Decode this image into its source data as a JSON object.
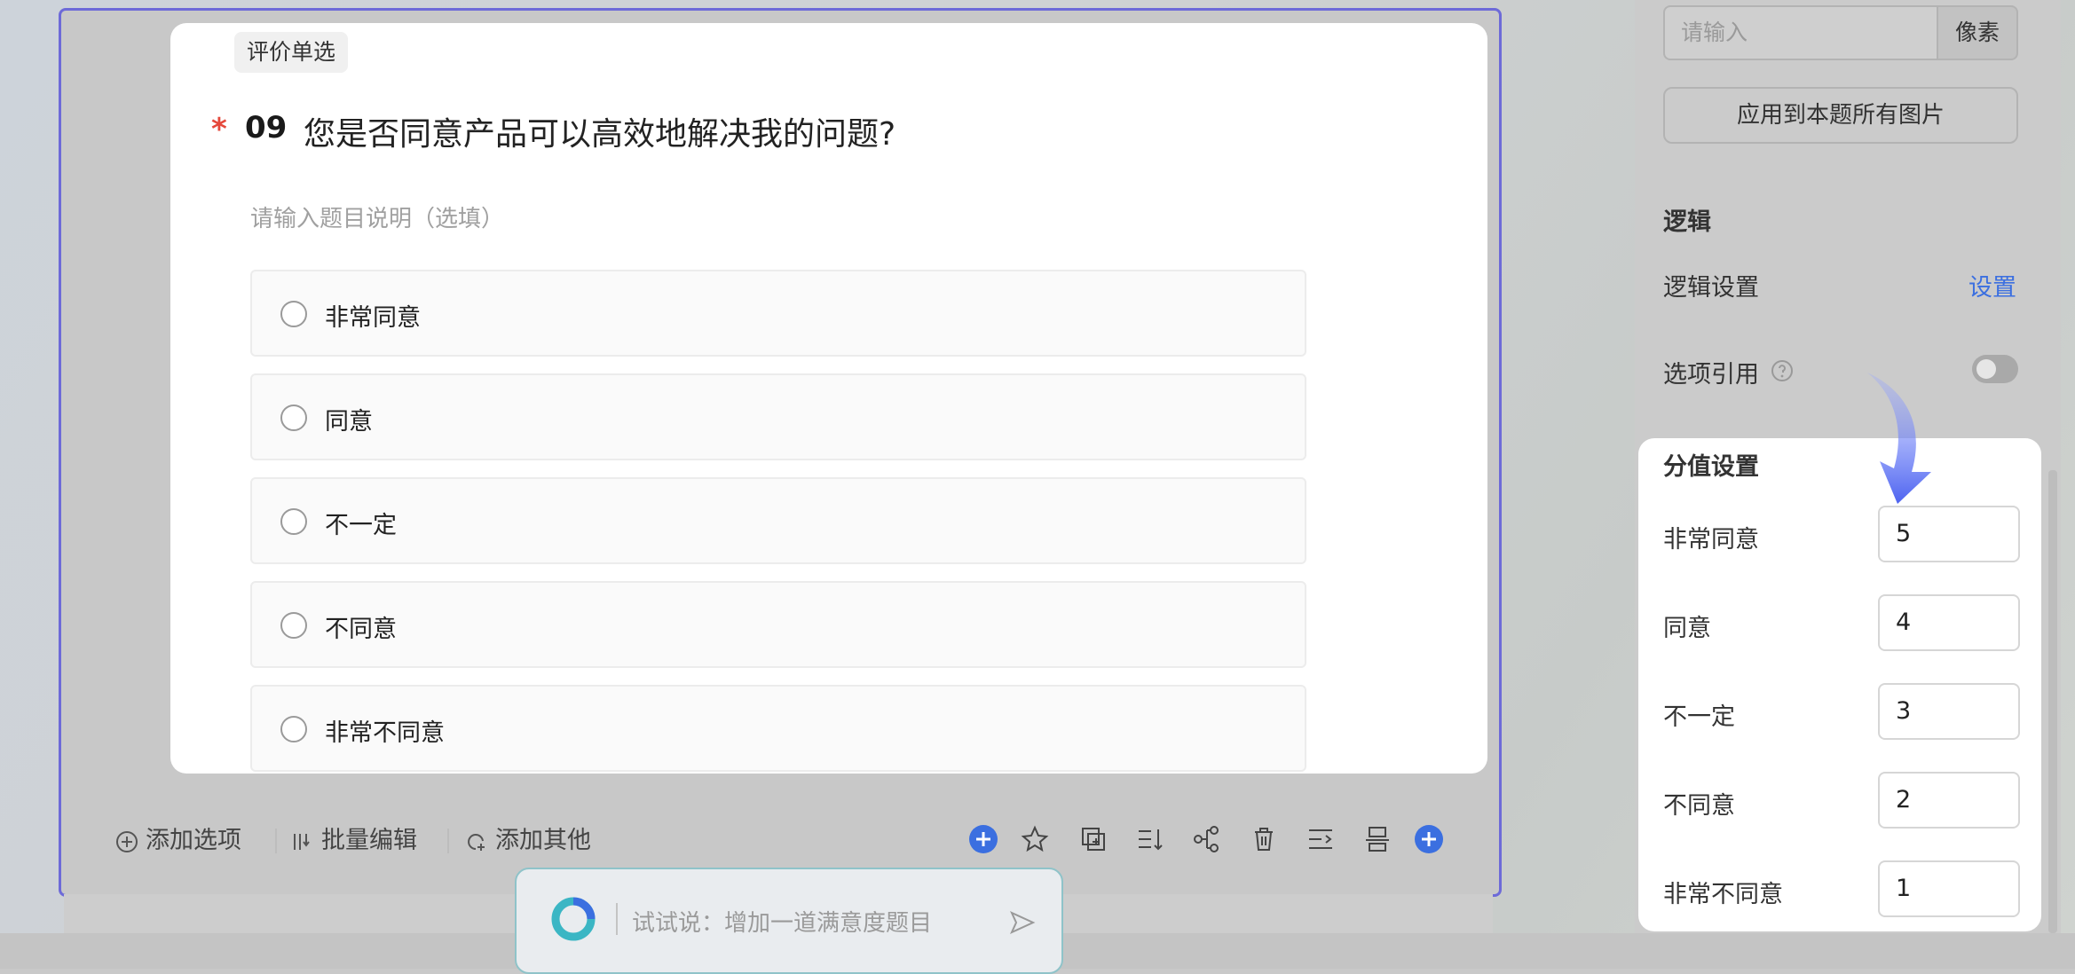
{
  "question": {
    "type_badge": "评价单选",
    "required_mark": "*",
    "number": "09",
    "title": "您是否同意产品可以高效地解决我的问题?",
    "description_placeholder": "请输入题目说明（选填）",
    "options": [
      {
        "label": "非常同意"
      },
      {
        "label": "同意"
      },
      {
        "label": "不一定"
      },
      {
        "label": "不同意"
      },
      {
        "label": "非常不同意"
      }
    ]
  },
  "toolbar": {
    "add_option": "添加选项",
    "batch_edit": "批量编辑",
    "add_other": "添加其他",
    "icons": [
      "add-circle-icon",
      "star-icon",
      "copy-icon",
      "sort-icon",
      "logic-tree-icon",
      "delete-icon",
      "indent-icon",
      "split-icon",
      "add-circle-icon"
    ]
  },
  "ai_assistant": {
    "placeholder": "试试说：增加一道满意度题目"
  },
  "settings_panel": {
    "size_input_placeholder": "请输入",
    "size_unit": "像素",
    "apply_all_images": "应用到本题所有图片",
    "logic_section_title": "逻辑",
    "logic_setting_label": "逻辑设置",
    "logic_setting_link": "设置",
    "option_reference_label": "选项引用",
    "option_reference_enabled": false,
    "score_section_title": "分值设置",
    "scores": [
      {
        "label": "非常同意",
        "value": "5"
      },
      {
        "label": "同意",
        "value": "4"
      },
      {
        "label": "不一定",
        "value": "3"
      },
      {
        "label": "不同意",
        "value": "2"
      },
      {
        "label": "非常不同意",
        "value": "1"
      }
    ]
  },
  "colors": {
    "accent_blue": "#3b6fe0",
    "focus_border": "#6d6ad8",
    "required_red": "#e5483b"
  }
}
